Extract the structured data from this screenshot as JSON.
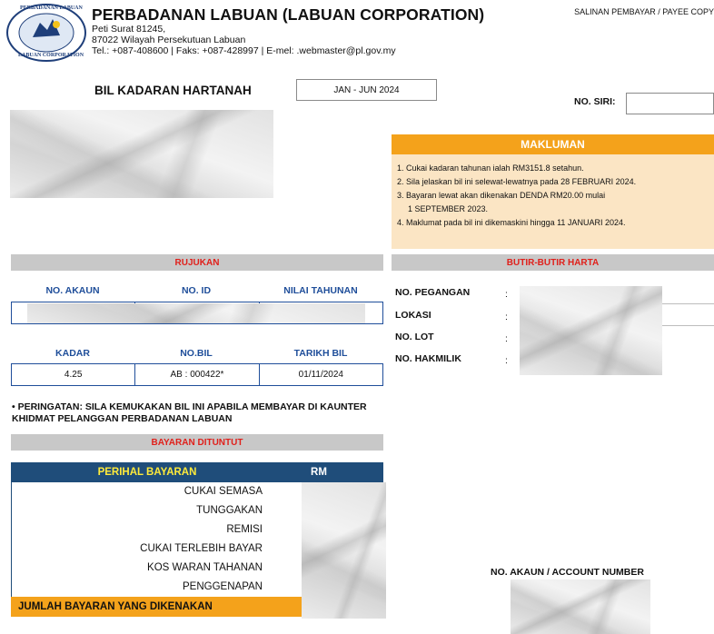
{
  "header": {
    "logo_text_top": "PERBADANAN LABUAN",
    "logo_text_bottom": "LABUAN CORPORATION",
    "org_title": "PERBADANAN LABUAN (LABUAN CORPORATION)",
    "address_line1": "Peti Surat 81245,",
    "address_line2": "87022 Wilayah Persekutuan Labuan",
    "contact_line": "Tel.: +087-408600 | Faks: +087-428997 | E-mel: .webmaster@pl.gov.my",
    "copy_label": "SALINAN PEMBAYAR / PAYEE COPY"
  },
  "bill": {
    "title": "BIL KADARAN HARTANAH",
    "period": "JAN - JUN 2024",
    "siri_label": "NO. SIRI:",
    "siri_value": ""
  },
  "makluman": {
    "heading": "MAKLUMAN",
    "lines": [
      "1. Cukai kadaran tahunan ialah RM3151.8 setahun.",
      "2. Sila jelaskan bil ini selewat-lewatnya pada 28 FEBRUARI 2024.",
      "3. Bayaran lewat akan dikenakan DENDA RM20.00 mulai",
      "1 SEPTEMBER 2023.",
      "4. Maklumat pada bil ini dikemaskini hingga 11 JANUARI 2024."
    ]
  },
  "rujukan": {
    "heading": "RUJUKAN",
    "row1_headers": [
      "NO. AKAUN",
      "NO. ID",
      "NILAI TAHUNAN"
    ],
    "row2_headers": [
      "KADAR",
      "NO.BIL",
      "TARIKH BIL"
    ],
    "row2_values": [
      "4.25",
      "AB : 000422*",
      "01/11/2024"
    ]
  },
  "harta": {
    "heading": "BUTIR-BUTIR HARTA",
    "labels": [
      "NO. PEGANGAN",
      "LOKASI",
      "NO. LOT",
      "NO. HAKMILIK"
    ],
    "colon": ":"
  },
  "warning": "• PERINGATAN: SILA KEMUKAKAN BIL INI APABILA MEMBAYAR DI KAUNTER KHIDMAT PELANGGAN PERBADANAN LABUAN",
  "bayaran": {
    "heading": "BAYARAN DITUNTUT",
    "col_perihal": "PERIHAL BAYARAN",
    "col_rm": "RM",
    "items": [
      "CUKAI SEMASA",
      "TUNGGAKAN",
      "REMISI",
      "CUKAI TERLEBIH BAYAR",
      "KOS WARAN TAHANAN",
      "PENGGENAPAN"
    ],
    "total_label": "JUMLAH BAYARAN YANG DIKENAKAN"
  },
  "account_number_label": "NO. AKAUN / ACCOUNT NUMBER",
  "colors": {
    "accent_orange": "#f4a21b",
    "navy": "#1f4d7a",
    "blue": "#1f4e9a",
    "red": "#e0201b"
  }
}
